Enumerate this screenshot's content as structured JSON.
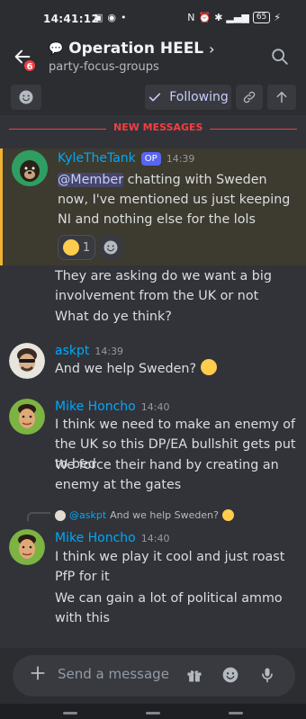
{
  "status_bar": {
    "time": "14:41:12",
    "battery": "65"
  },
  "header": {
    "title": "Operation HEEL",
    "channel": "party-focus-groups",
    "back_badge": "6"
  },
  "toolbar": {
    "following_label": "Following"
  },
  "divider": {
    "label": "NEW MESSAGES"
  },
  "messages": [
    {
      "author": "KyleTheTank",
      "badge": "OP",
      "time": "14:39",
      "mention": "@Member",
      "text": " chatting with Sweden now, I've mentioned us just keeping NI and nothing else for the lols",
      "reaction_count": "1"
    },
    {
      "text": "They are asking do we want a big involvement from the UK or not"
    },
    {
      "text": "What do ye think?"
    },
    {
      "author": "askpt",
      "time": "14:39",
      "text": "And we help Sweden?"
    },
    {
      "author": "Mike Honcho",
      "time": "14:40",
      "text": "I think we need to make an enemy of the UK so this DP/EA bullshit gets put to bed"
    },
    {
      "text": "We force their hand by creating an enemy at the gates"
    },
    {
      "reply_user": "@askpt",
      "reply_text": "And we help Sweden?",
      "author": "Mike Honcho",
      "time": "14:40",
      "text": "I think we play it cool and just roast PfP for it"
    },
    {
      "text": "We can gain a lot of political ammo with this"
    }
  ],
  "composer": {
    "placeholder": "Send a message i..."
  },
  "icons": {
    "back": "arrow-left-icon",
    "search": "search-icon",
    "emoji": "emoji-icon",
    "check": "check-icon",
    "link": "link-icon",
    "up": "arrow-up-icon",
    "plus": "plus-icon",
    "gift": "gift-icon",
    "mic": "mic-icon"
  },
  "colors": {
    "accent": "#5865f2",
    "username": "#00a8fc",
    "new_messages": "#f23f43",
    "mention_bar": "#f0b232"
  }
}
